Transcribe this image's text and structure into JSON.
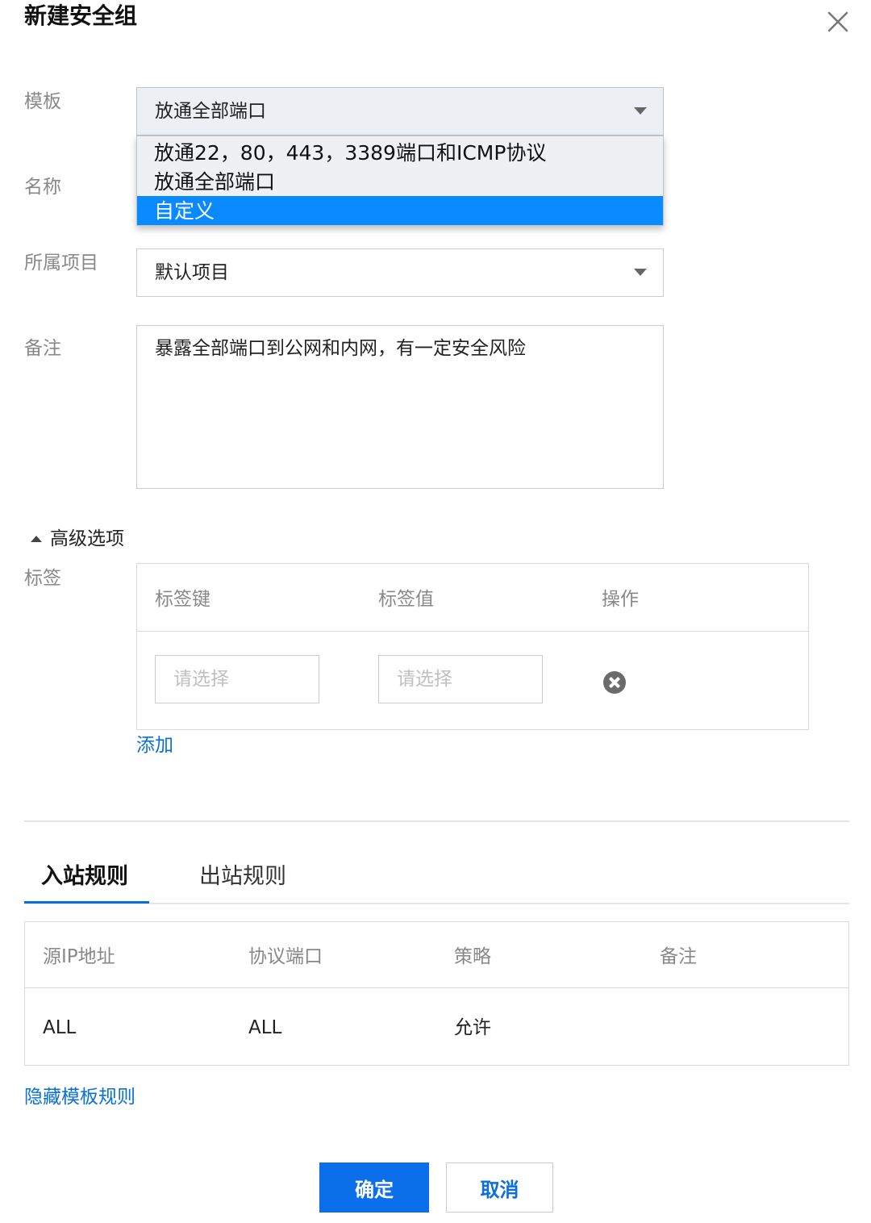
{
  "dialog": {
    "title": "新建安全组"
  },
  "form": {
    "template": {
      "label": "模板",
      "value": "放通全部端口",
      "options": [
        "放通22，80，443，3389端口和ICMP协议",
        "放通全部端口",
        "自定义"
      ],
      "highlighted_option": "自定义"
    },
    "name": {
      "label": "名称"
    },
    "project": {
      "label": "所属项目",
      "value": "默认项目"
    },
    "remark": {
      "label": "备注",
      "value": "暴露全部端口到公网和内网，有一定安全风险"
    }
  },
  "advanced": {
    "toggle_label": "高级选项",
    "tags": {
      "label": "标签",
      "columns": [
        "标签键",
        "标签值",
        "操作"
      ],
      "key_placeholder": "请选择",
      "value_placeholder": "请选择",
      "add_label": "添加"
    }
  },
  "tabs": [
    {
      "label": "入站规则",
      "active": true
    },
    {
      "label": "出站规则",
      "active": false
    }
  ],
  "rules_table": {
    "columns": [
      "源IP地址",
      "协议端口",
      "策略",
      "备注"
    ],
    "rows": [
      [
        "ALL",
        "ALL",
        "允许",
        ""
      ]
    ]
  },
  "hide_template_rules_label": "隐藏模板规则",
  "buttons": {
    "confirm": "确定",
    "cancel": "取消"
  },
  "colors": {
    "accent": "#0a6fe8",
    "highlight": "#0a8aff",
    "link": "#0a6fd8"
  }
}
